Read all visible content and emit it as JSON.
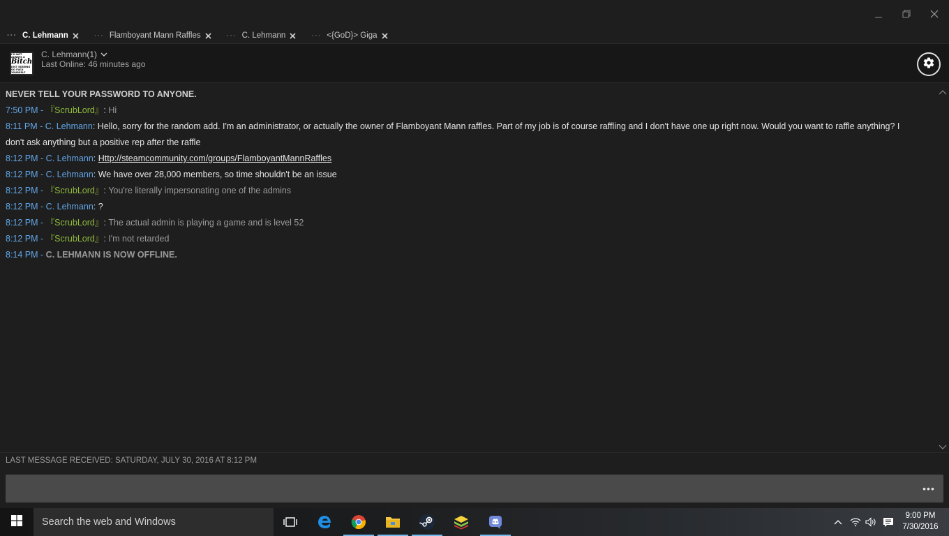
{
  "window": {
    "controls": [
      "minimize-icon",
      "restore-icon",
      "close-icon"
    ]
  },
  "tabs": [
    {
      "label": "C. Lehmann",
      "active": true
    },
    {
      "label": "Flamboyant Mann Raffles",
      "active": false
    },
    {
      "label": "C. Lehmann",
      "active": false
    },
    {
      "label": "<{GoD}> Giga",
      "active": false
    }
  ],
  "header": {
    "avatar_text": {
      "line1": "I'M NOT ALWAYS A",
      "line2": "Bitch",
      "line3": "JUST KIDDING GO FUCK YOURSELF"
    },
    "friend_name": "C. Lehmann",
    "friend_count": "(1)",
    "last_online": "Last Online: 46 minutes ago"
  },
  "chat": {
    "warning": "NEVER TELL YOUR PASSWORD TO ANYONE.",
    "messages": [
      {
        "time": "7:50 PM",
        "sep": " - ",
        "sender": "『ScrubLord』",
        "colon": ": ",
        "text": "Hi"
      },
      {
        "time": "8:11 PM",
        "sep": " - ",
        "sender": "C. Lehmann",
        "colon": ": ",
        "text": "Hello, sorry for the random add. I'm an administrator, or actually the owner of Flamboyant Mann raffles. Part of my job is of course raffling and I don't have one up right now. Would you want to raffle anything? I don't ask anything but a positive rep after the raffle"
      },
      {
        "time": "8:12 PM",
        "sep": " - ",
        "sender": "C. Lehmann",
        "colon": ": ",
        "text": "Http://steamcommunity.com/groups/FlamboyantMannRaffles"
      },
      {
        "time": "8:12 PM",
        "sep": " - ",
        "sender": "C. Lehmann",
        "colon": ": ",
        "text": "We have over 28,000 members, so time shouldn't be an issue"
      },
      {
        "time": "8:12 PM",
        "sep": " - ",
        "sender": "『ScrubLord』",
        "colon": ": ",
        "text": "You're literally impersonating one of the admins"
      },
      {
        "time": "8:12 PM",
        "sep": " - ",
        "sender": "C. Lehmann",
        "colon": ": ",
        "text": "?"
      },
      {
        "time": "8:12 PM",
        "sep": " - ",
        "sender": "『ScrubLord』",
        "colon": ": ",
        "text": "The actual admin is playing a game and is level 52"
      },
      {
        "time": "8:12 PM",
        "sep": " - ",
        "sender": "『ScrubLord』",
        "colon": ": ",
        "text": "I'm not retarded"
      }
    ],
    "offline": {
      "time": "8:14 PM",
      "sep": " - ",
      "text": "C. LEHMANN IS NOW OFFLINE."
    }
  },
  "status": {
    "last_received": "LAST MESSAGE RECEIVED: SATURDAY, JULY 30, 2016 AT 8:12 PM"
  },
  "input": {
    "value": "",
    "more_label": "•••"
  },
  "taskbar": {
    "search_placeholder": "Search the web and Windows",
    "apps": [
      "task-view-icon",
      "edge-icon",
      "chrome-icon",
      "file-explorer-icon",
      "steam-icon",
      "bluestacks-icon",
      "discord-icon"
    ],
    "tray": [
      "chevron-up-icon",
      "network-icon",
      "volume-icon",
      "action-center-icon"
    ],
    "clock_time": "9:00 PM",
    "clock_date": "7/30/2016"
  },
  "colors": {
    "time": "#62a6e8",
    "me_name": "#62a6e8",
    "scrublord_name": "#90ba3c",
    "background": "#1e1e1e"
  }
}
